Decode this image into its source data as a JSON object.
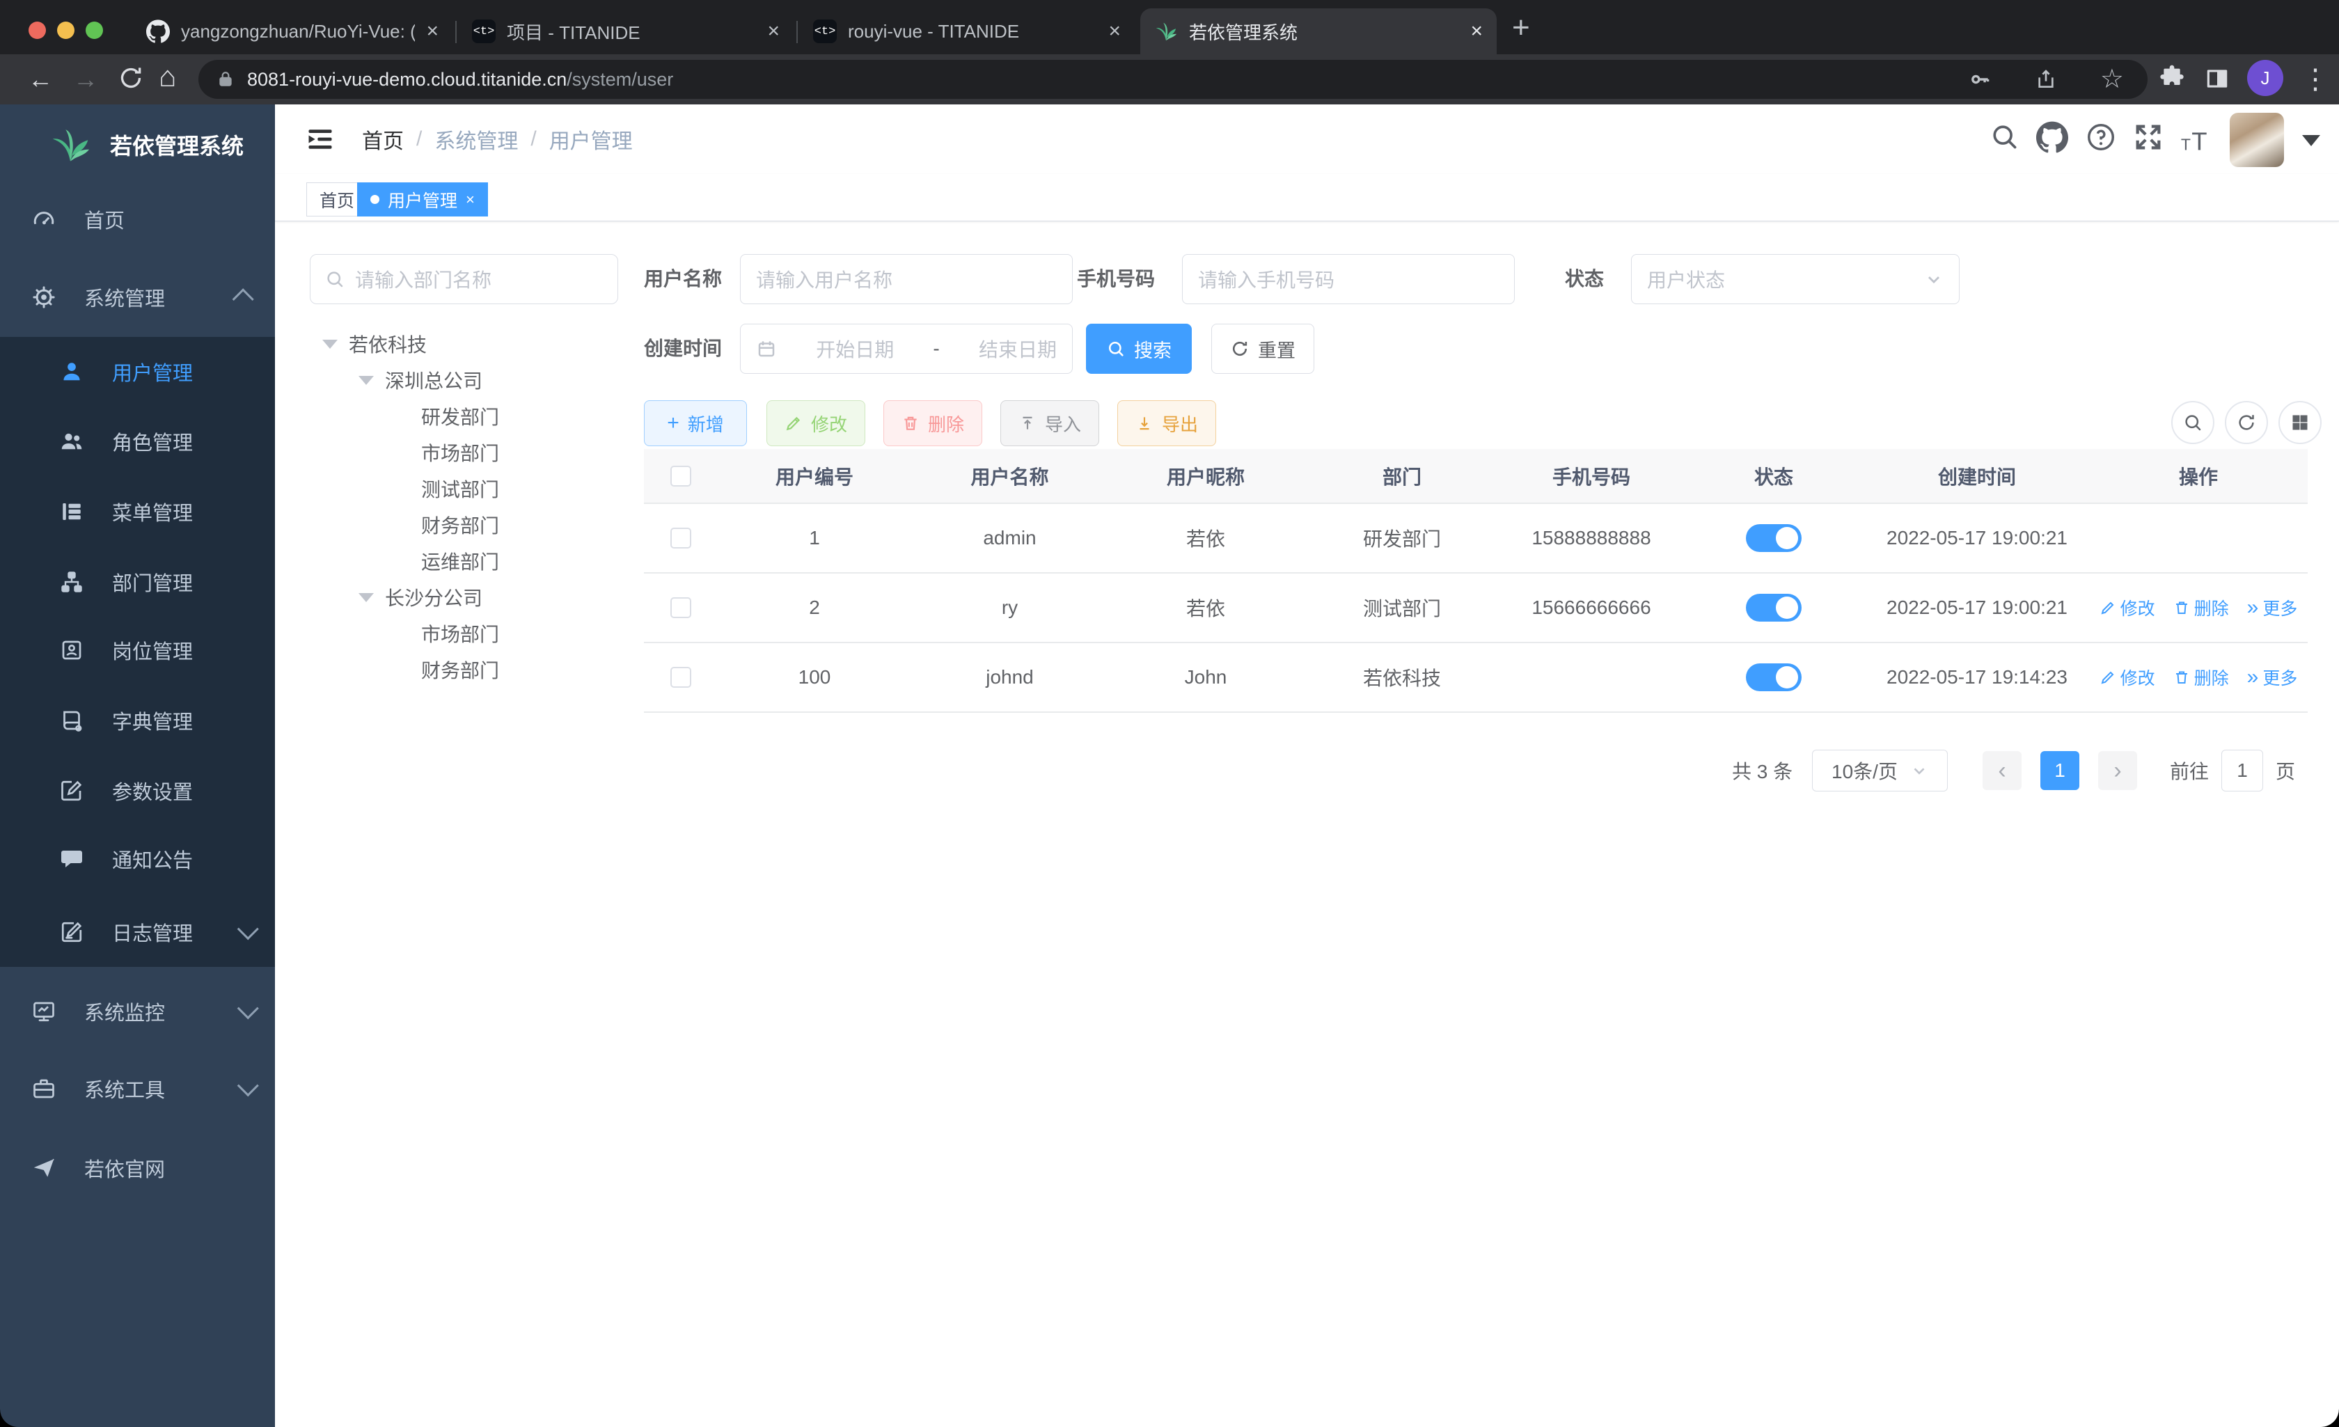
{
  "colors": {
    "primary": "#409eff",
    "success": "#67c23a",
    "danger": "#f56c6c",
    "warning": "#e6a23c",
    "info": "#909399",
    "sidebar_bg": "#304156",
    "submenu_bg": "#1f2d3d",
    "sidebar_text": "#bfcbd9",
    "chrome_frame": "#202124",
    "chrome_toolbar": "#35363a",
    "traffic_red": "#ed6a5e",
    "traffic_yellow": "#f4bf4f",
    "traffic_green": "#61c454"
  },
  "icons": {
    "close": "×",
    "plus": "+",
    "more": "»",
    "back": "←",
    "forward": "→",
    "home": "⌂",
    "star": "☆",
    "menu_dots": "⋮",
    "prev": "‹",
    "next": "›",
    "date_sep": "-",
    "titanide_glyph": "<t>"
  },
  "browser": {
    "tabs": [
      {
        "title": "yangzongzhuan/RuoYi-Vue: (R"
      },
      {
        "title": "项目 - TITANIDE"
      },
      {
        "title": "rouyi-vue - TITANIDE"
      },
      {
        "title": "若依管理系统"
      }
    ],
    "url": {
      "host": "8081-rouyi-vue-demo.cloud.titanide.cn",
      "path": "/system/user"
    },
    "profile_initial": "J"
  },
  "sidebar": {
    "title": "若依管理系统",
    "items": [
      {
        "label": "首页"
      },
      {
        "label": "系统管理"
      },
      {
        "label": "用户管理"
      },
      {
        "label": "角色管理"
      },
      {
        "label": "菜单管理"
      },
      {
        "label": "部门管理"
      },
      {
        "label": "岗位管理"
      },
      {
        "label": "字典管理"
      },
      {
        "label": "参数设置"
      },
      {
        "label": "通知公告"
      },
      {
        "label": "日志管理"
      },
      {
        "label": "系统监控"
      },
      {
        "label": "系统工具"
      },
      {
        "label": "若依官网"
      }
    ]
  },
  "header": {
    "breadcrumb": [
      "首页",
      "系统管理",
      "用户管理"
    ]
  },
  "tags": [
    {
      "label": "首页"
    },
    {
      "label": "用户管理"
    }
  ],
  "dept_panel": {
    "search_placeholder": "请输入部门名称",
    "tree": [
      {
        "label": "若依科技"
      },
      {
        "label": "深圳总公司"
      },
      {
        "label": "研发部门"
      },
      {
        "label": "市场部门"
      },
      {
        "label": "测试部门"
      },
      {
        "label": "财务部门"
      },
      {
        "label": "运维部门"
      },
      {
        "label": "长沙分公司"
      },
      {
        "label": "市场部门"
      },
      {
        "label": "财务部门"
      }
    ]
  },
  "filter": {
    "username_label": "用户名称",
    "username_placeholder": "请输入用户名称",
    "phone_label": "手机号码",
    "phone_placeholder": "请输入手机号码",
    "status_label": "状态",
    "status_placeholder": "用户状态",
    "date_label": "创建时间",
    "date_start": "开始日期",
    "date_end": "结束日期",
    "search": "搜索",
    "reset": "重置"
  },
  "toolbar": {
    "add": "新增",
    "edit": "修改",
    "del": "删除",
    "imp": "导入",
    "exp": "导出"
  },
  "table": {
    "columns": [
      "用户编号",
      "用户名称",
      "用户昵称",
      "部门",
      "手机号码",
      "状态",
      "创建时间",
      "操作"
    ],
    "ops": {
      "edit": "修改",
      "del": "删除",
      "more": "更多"
    },
    "rows": [
      {
        "id": "1",
        "username": "admin",
        "nickname": "若依",
        "dept": "研发部门",
        "phone": "15888888888",
        "created": "2022-05-17 19:00:21"
      },
      {
        "id": "2",
        "username": "ry",
        "nickname": "若依",
        "dept": "测试部门",
        "phone": "15666666666",
        "created": "2022-05-17 19:00:21"
      },
      {
        "id": "100",
        "username": "johnd",
        "nickname": "John",
        "dept": "若依科技",
        "phone": "",
        "created": "2022-05-17 19:14:23"
      }
    ]
  },
  "pagination": {
    "total": "共 3 条",
    "size": "10条/页",
    "page": "1",
    "goto": "前往",
    "goto_value": "1",
    "unit": "页"
  }
}
